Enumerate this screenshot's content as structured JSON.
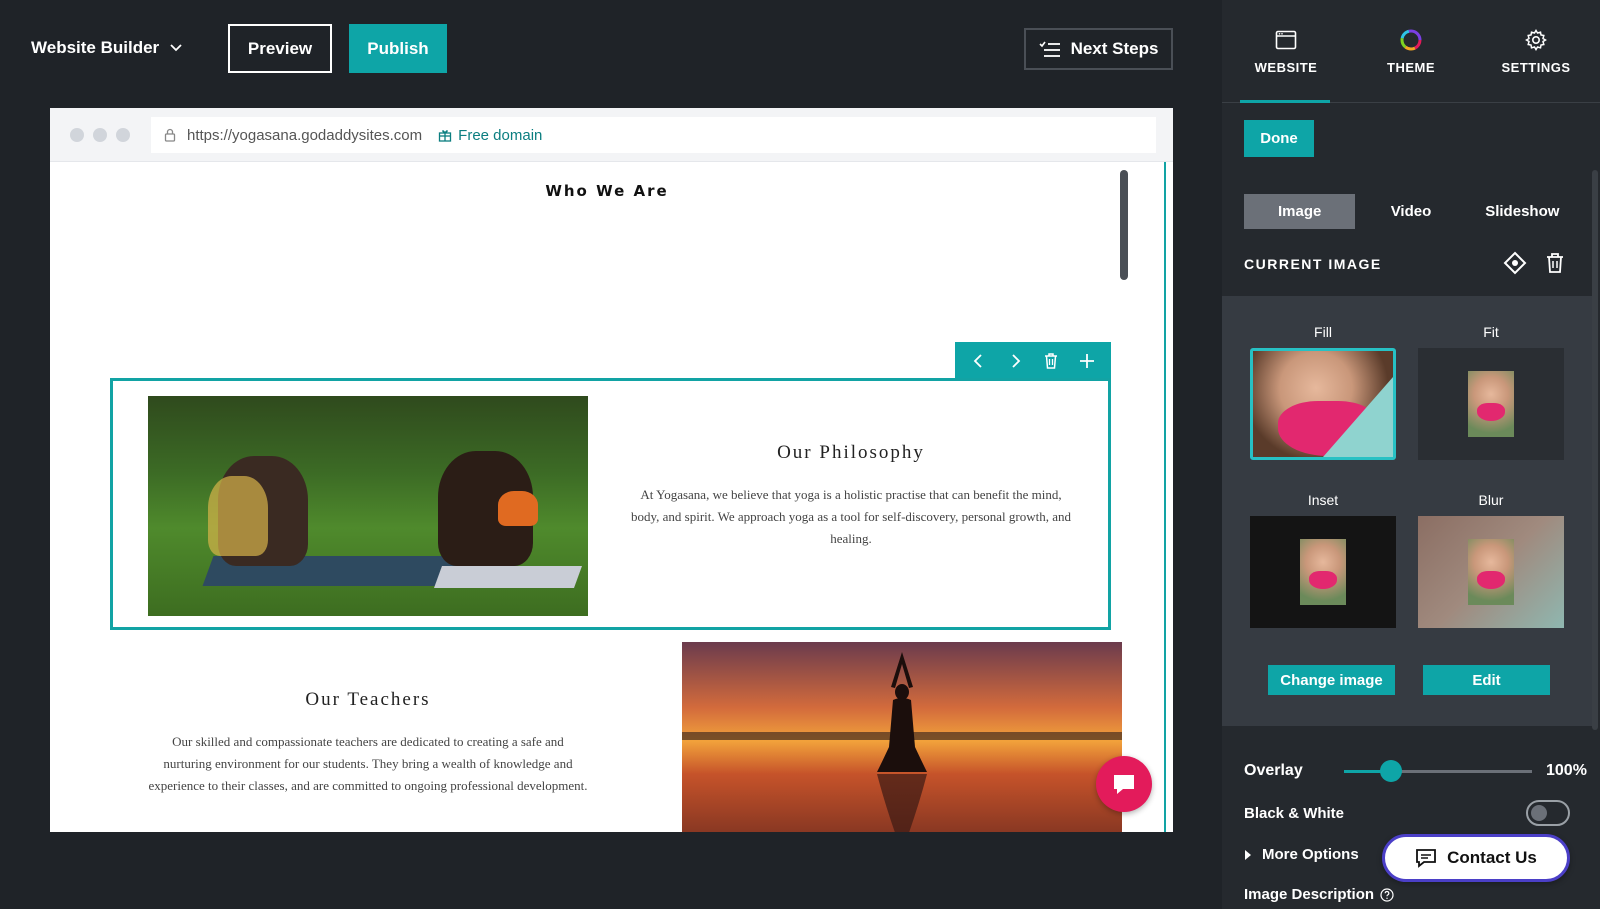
{
  "topbar": {
    "brand": "Website Builder",
    "preview_label": "Preview",
    "publish_label": "Publish",
    "next_steps_label": "Next Steps"
  },
  "browser": {
    "url": "https://yogasana.godaddysites.com",
    "free_domain_label": "Free domain"
  },
  "page": {
    "section_title": "Who We Are",
    "blocks": [
      {
        "heading": "Our Philosophy",
        "body": "At Yogasana, we believe that yoga is a holistic practise that can benefit the mind, body, and spirit. We approach yoga as a tool for self-discovery, personal growth, and healing."
      },
      {
        "heading": "Our Teachers",
        "body": "Our skilled and compassionate teachers are dedicated to creating a safe and nurturing environment for our students. They bring a wealth of knowledge and experience to their classes, and are committed to ongoing professional development."
      }
    ]
  },
  "panel": {
    "tabs": [
      {
        "label": "WEBSITE",
        "icon": "browser-window-icon",
        "active": true
      },
      {
        "label": "THEME",
        "icon": "color-wheel-icon",
        "active": false
      },
      {
        "label": "SETTINGS",
        "icon": "gear-icon",
        "active": false
      }
    ],
    "done_label": "Done",
    "media_types": [
      "Image",
      "Video",
      "Slideshow"
    ],
    "active_media_type": "Image",
    "current_image_label": "CURRENT IMAGE",
    "fit_options": [
      {
        "label": "Fill",
        "selected": true
      },
      {
        "label": "Fit",
        "selected": false
      },
      {
        "label": "Inset",
        "selected": false
      },
      {
        "label": "Blur",
        "selected": false
      }
    ],
    "change_image_label": "Change image",
    "edit_label": "Edit",
    "overlay_label": "Overlay",
    "overlay_value": "100%",
    "overlay_fraction": 0.25,
    "black_white_label": "Black & White",
    "black_white_on": false,
    "more_options_label": "More Options",
    "image_description_label": "Image Description"
  },
  "contact_label": "Contact Us",
  "colors": {
    "accent": "#0ea5a7",
    "chat": "#e31b5b",
    "contact_border": "#4b3fc7",
    "background": "#1f2328"
  }
}
